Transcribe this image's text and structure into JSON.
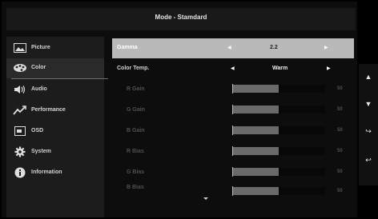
{
  "header": {
    "title": "Mode - Stamdard"
  },
  "sidebar": {
    "items": [
      {
        "label": "Picture",
        "icon": "picture-icon"
      },
      {
        "label": "Color",
        "icon": "color-palette-icon"
      },
      {
        "label": "Audio",
        "icon": "speaker-icon"
      },
      {
        "label": "Performance",
        "icon": "performance-graph-icon"
      },
      {
        "label": "OSD",
        "icon": "osd-screen-icon"
      },
      {
        "label": "System",
        "icon": "gear-icon"
      },
      {
        "label": "Information",
        "icon": "info-icon"
      }
    ],
    "active_index": 1
  },
  "color_menu": {
    "selected_index": 0,
    "rows": [
      {
        "label": "Gamma",
        "value": "2.2",
        "selected": true
      },
      {
        "label": "Color Temp.",
        "value": "Warm"
      },
      {
        "label": "R Gain",
        "value": "50",
        "level": 0.5,
        "disabled": true
      },
      {
        "label": "G Gain",
        "value": "50",
        "level": 0.5,
        "disabled": true
      },
      {
        "label": "B Gain",
        "value": "50",
        "level": 0.5,
        "disabled": true
      },
      {
        "label": "R Bias",
        "value": "50",
        "level": 0.5,
        "disabled": true
      },
      {
        "label": "G Bias",
        "value": "50",
        "level": 0.5,
        "disabled": true
      },
      {
        "label": "B Bias",
        "value": "50",
        "level": 0.5,
        "disabled": true
      }
    ]
  },
  "hotkeys": [
    {
      "icon": "up-arrow-icon",
      "glyph": "▲"
    },
    {
      "icon": "down-arrow-icon",
      "glyph": "▼"
    },
    {
      "icon": "enter-icon",
      "glyph": "↪"
    },
    {
      "icon": "back-icon",
      "glyph": "↩"
    }
  ],
  "colors": {
    "selection": "#b9b9b9",
    "background": "#0d0d0d",
    "sidebar": "#1c1c1c",
    "disabled_text": "#505050"
  }
}
